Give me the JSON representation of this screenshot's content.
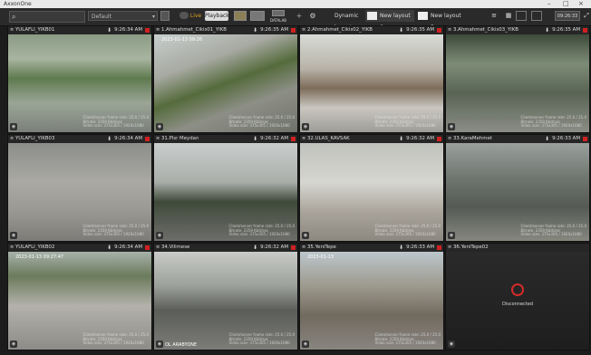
{
  "app": {
    "title": "AxxonOne"
  },
  "toolbar": {
    "search_placeholder": "",
    "preset": "Default",
    "live_label": "Live",
    "playback_label": "Playback",
    "datalab_label": "DATALAB",
    "layouts": [
      {
        "label": "Dynamic layout",
        "active": false
      },
      {
        "label": "New layout 6",
        "active": true
      },
      {
        "label": "New layout 5",
        "active": false
      }
    ],
    "clock": "09:26:33"
  },
  "cameras": [
    {
      "name": "YULAFLI_YIKB01",
      "time": "9:26:34 AM",
      "scene": "trees"
    },
    {
      "name": "1.Ahmahmet_Cikis01_YIKB",
      "time": "9:26:35 AM",
      "scene": "road"
    },
    {
      "name": "2.Ahmahmet_Cikis02_YIKB",
      "time": "9:26:35 AM",
      "scene": "field"
    },
    {
      "name": "3.Ahmahmet_Cikis03_YIKB",
      "time": "9:26:35 AM",
      "scene": "grain"
    },
    {
      "name": "YULAFLI_YIKB03",
      "time": "9:26:34 AM",
      "scene": "ground"
    },
    {
      "name": "31.Plsr Meydan",
      "time": "9:26:32 AM",
      "scene": "fog"
    },
    {
      "name": "32.ULAS_KAVSAK",
      "time": "9:26:32 AM",
      "scene": "blur"
    },
    {
      "name": "33.KaraMehmet",
      "time": "9:26:33 AM",
      "scene": "street"
    },
    {
      "name": "YULAFLI_YIKB02",
      "time": "9:26:34 AM",
      "scene": "lot"
    },
    {
      "name": "34.Vilimese",
      "time": "9:26:32 AM",
      "scene": "yard"
    },
    {
      "name": "35.YeniTepe",
      "time": "9:26:33 AM",
      "scene": "town"
    },
    {
      "name": "36.YeniTepe02",
      "time": "",
      "scene": "disconnected"
    }
  ],
  "overlay_lines": [
    "Client/server frame rate: 25.0 / 25.0",
    "Bitrate: 2359 Kbit/sec",
    "Video size: 375x305 / 1920x1080"
  ],
  "stamps": {
    "t1": "2023-01-13 09:26",
    "t9": "2023-01-13 09:27:47",
    "t11": "2023-01-13"
  },
  "tile_icon": "camera-icon",
  "disconnected_label": "Disconnected",
  "vilimese_badge": "OL ARABYONE"
}
